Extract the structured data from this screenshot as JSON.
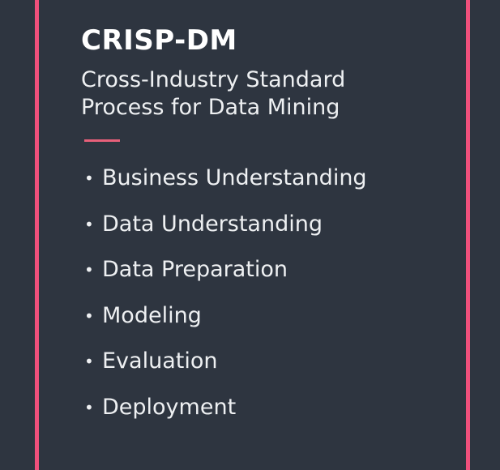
{
  "slide": {
    "title": "CRISP-DM",
    "subtitle_line1": "Cross-Industry Standard",
    "subtitle_line2": "Process for Data Mining",
    "bullet_glyph": "•",
    "steps": [
      "Business Understanding",
      "Data Understanding",
      "Data Preparation",
      "Modeling",
      "Evaluation",
      "Deployment"
    ]
  },
  "colors": {
    "background": "#2e3540",
    "frame_border": "#f0507c",
    "accent_line": "#e8607a",
    "text": "#ffffff"
  }
}
